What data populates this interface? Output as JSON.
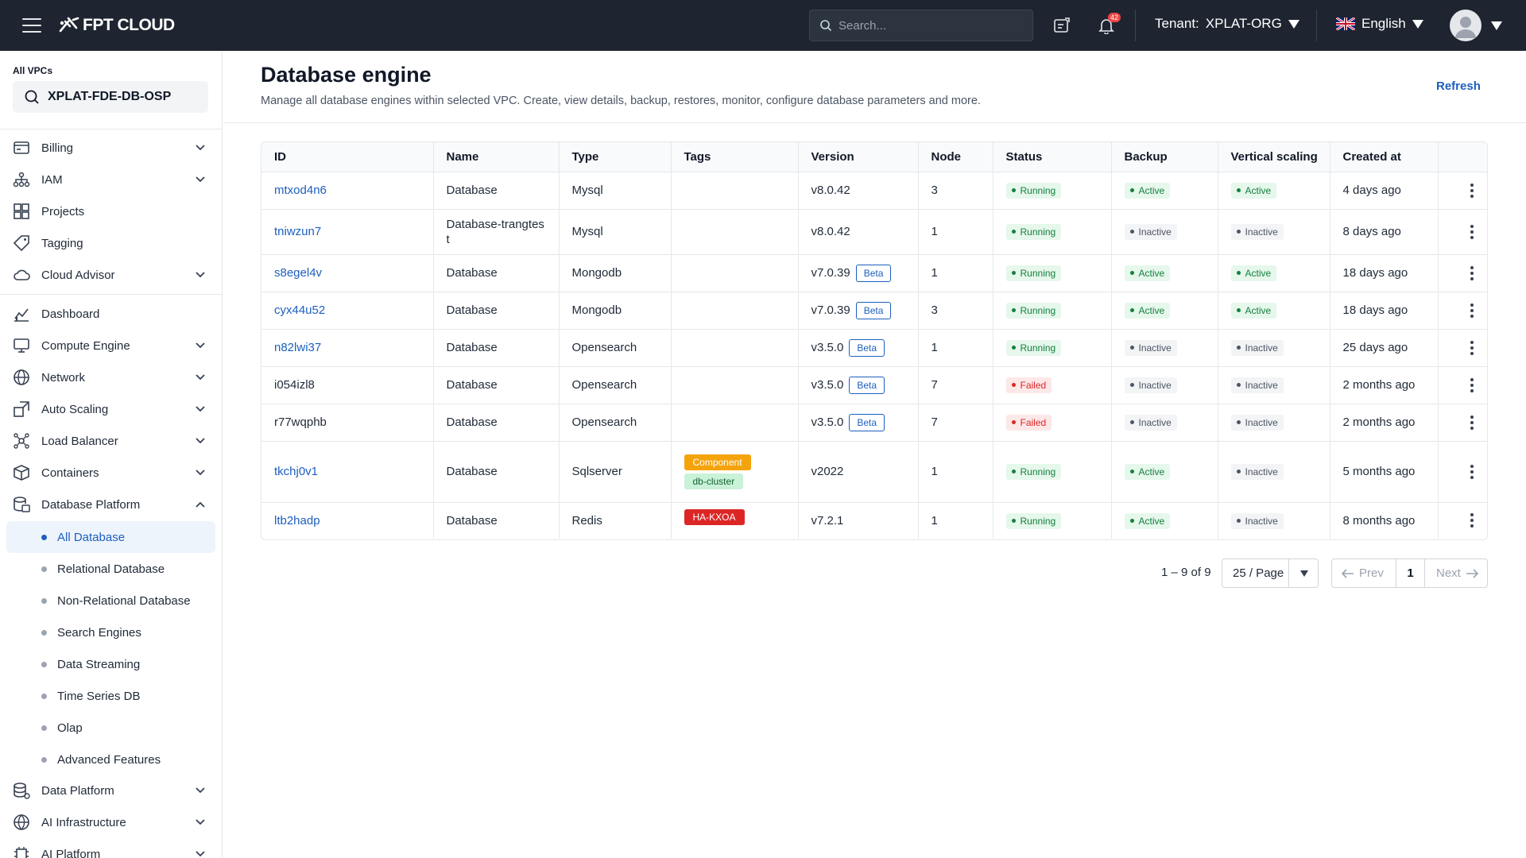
{
  "topbar": {
    "logo_text": "FPT CLOUD",
    "search_placeholder": "Search...",
    "notification_count": "42",
    "tenant_label": "Tenant:",
    "tenant_value": "XPLAT-ORG",
    "language": "English"
  },
  "sidebar": {
    "vpc_label": "All VPCs",
    "vpc_value": "XPLAT-FDE-DB-OSP",
    "group1": [
      {
        "label": "Billing",
        "icon": "billing-icon",
        "expandable": true
      },
      {
        "label": "IAM",
        "icon": "iam-icon",
        "expandable": true
      },
      {
        "label": "Projects",
        "icon": "projects-icon",
        "expandable": false
      },
      {
        "label": "Tagging",
        "icon": "tag-icon",
        "expandable": false
      },
      {
        "label": "Cloud Advisor",
        "icon": "cloud-icon",
        "expandable": true
      }
    ],
    "group2": [
      {
        "label": "Dashboard",
        "icon": "dashboard-icon",
        "expandable": false
      },
      {
        "label": "Compute Engine",
        "icon": "monitor-icon",
        "expandable": true
      },
      {
        "label": "Network",
        "icon": "globe-icon",
        "expandable": true
      },
      {
        "label": "Auto Scaling",
        "icon": "scaling-icon",
        "expandable": true
      },
      {
        "label": "Load Balancer",
        "icon": "load-balancer-icon",
        "expandable": true
      },
      {
        "label": "Containers",
        "icon": "container-icon",
        "expandable": true
      },
      {
        "label": "Database Platform",
        "icon": "database-icon",
        "expandable": true,
        "expanded": true
      }
    ],
    "database_sub": [
      {
        "label": "All Database",
        "active": true
      },
      {
        "label": "Relational Database"
      },
      {
        "label": "Non-Relational Database"
      },
      {
        "label": "Search Engines"
      },
      {
        "label": "Data Streaming"
      },
      {
        "label": "Time Series DB"
      },
      {
        "label": "Olap"
      },
      {
        "label": "Advanced Features"
      }
    ],
    "group3": [
      {
        "label": "Data Platform",
        "icon": "data-platform-icon",
        "expandable": true
      },
      {
        "label": "AI Infrastructure",
        "icon": "ai-infra-icon",
        "expandable": true
      },
      {
        "label": "AI Platform",
        "icon": "ai-platform-icon",
        "expandable": true
      }
    ]
  },
  "main": {
    "title": "Database engine",
    "subtitle": "Manage all database engines within selected VPC. Create, view details, backup, restores, monitor, configure database parameters and more.",
    "refresh_label": "Refresh"
  },
  "table": {
    "columns": [
      "ID",
      "Name",
      "Type",
      "Tags",
      "Version",
      "Node",
      "Status",
      "Backup",
      "Vertical scaling",
      "Created at",
      ""
    ],
    "rows": [
      {
        "id": "mtxod4n6",
        "id_link": true,
        "name": "Database",
        "type": "Mysql",
        "tags": [],
        "version": "v8.0.42",
        "beta": false,
        "node": "3",
        "status": "Running",
        "backup": "Active",
        "vscaling": "Active",
        "created": "4 days ago"
      },
      {
        "id": "tniwzun7",
        "id_link": true,
        "name": "Database-trangtes\nt",
        "type": "Mysql",
        "tags": [],
        "version": "v8.0.42",
        "beta": false,
        "node": "1",
        "status": "Running",
        "backup": "Inactive",
        "vscaling": "Inactive",
        "created": "8 days ago"
      },
      {
        "id": "s8egel4v",
        "id_link": true,
        "name": "Database",
        "type": "Mongodb",
        "tags": [],
        "version": "v7.0.39",
        "beta": true,
        "node": "1",
        "status": "Running",
        "backup": "Active",
        "vscaling": "Active",
        "created": "18 days ago"
      },
      {
        "id": "cyx44u52",
        "id_link": true,
        "name": "Database",
        "type": "Mongodb",
        "tags": [],
        "version": "v7.0.39",
        "beta": true,
        "node": "3",
        "status": "Running",
        "backup": "Active",
        "vscaling": "Active",
        "created": "18 days ago"
      },
      {
        "id": "n82lwi37",
        "id_link": true,
        "name": "Database",
        "type": "Opensearch",
        "tags": [],
        "version": "v3.5.0",
        "beta": true,
        "node": "1",
        "status": "Running",
        "backup": "Inactive",
        "vscaling": "Inactive",
        "created": "25 days ago"
      },
      {
        "id": "i054izl8",
        "id_link": false,
        "name": "Database",
        "type": "Opensearch",
        "tags": [],
        "version": "v3.5.0",
        "beta": true,
        "node": "7",
        "status": "Failed",
        "backup": "Inactive",
        "vscaling": "Inactive",
        "created": "2 months ago"
      },
      {
        "id": "r77wqphb",
        "id_link": false,
        "name": "Database",
        "type": "Opensearch",
        "tags": [],
        "version": "v3.5.0",
        "beta": true,
        "node": "7",
        "status": "Failed",
        "backup": "Inactive",
        "vscaling": "Inactive",
        "created": "2 months ago"
      },
      {
        "id": "tkchj0v1",
        "id_link": true,
        "name": "Database",
        "type": "Sqlserver",
        "tags": [
          {
            "text": "Component",
            "style": "amber"
          },
          {
            "text": "db-cluster",
            "style": "mint"
          }
        ],
        "version": "v2022",
        "beta": false,
        "node": "1",
        "status": "Running",
        "backup": "Active",
        "vscaling": "Inactive",
        "created": "5 months ago"
      },
      {
        "id": "ltb2hadp",
        "id_link": true,
        "name": "Database",
        "type": "Redis",
        "tags": [
          {
            "text": "HA-KXOA",
            "style": "red"
          }
        ],
        "version": "v7.2.1",
        "beta": false,
        "node": "1",
        "status": "Running",
        "backup": "Active",
        "vscaling": "Inactive",
        "created": "8 months ago"
      }
    ],
    "beta_label": "Beta"
  },
  "pagination": {
    "summary": "1 – 9 of 9",
    "page_size": "25 / Page",
    "prev": "Prev",
    "current": "1",
    "next": "Next"
  },
  "colors": {
    "topbar": "#1e2530",
    "accent": "#1d5fbf",
    "running": "#15803d",
    "failed": "#dc2626"
  }
}
